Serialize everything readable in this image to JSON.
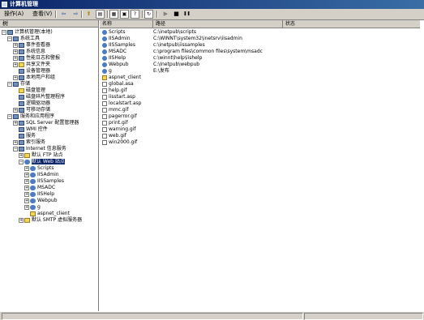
{
  "window": {
    "title": "计算机管理"
  },
  "menu": {
    "action": "操作(A)",
    "view": "查看(V)"
  },
  "toolbar": {
    "back": "⇦",
    "forward": "⇨",
    "up": "⬆",
    "show_tree": "▤",
    "export": "▦",
    "properties": "▣",
    "help": "?",
    "refresh": "↻",
    "play": "▶",
    "stop": "■",
    "pause": "❚❚"
  },
  "left_pane": {
    "header": "树",
    "tree": [
      {
        "label": "计算机管理(本地)",
        "icon": "computer-icon"
      },
      {
        "label": "系统工具",
        "icon": "tools-icon"
      },
      {
        "label": "事件查看器",
        "icon": "event-viewer-icon"
      },
      {
        "label": "系统信息",
        "icon": "system-info-icon"
      },
      {
        "label": "性能日志和警报",
        "icon": "performance-icon"
      },
      {
        "label": "共享文件夹",
        "icon": "shared-folder-icon"
      },
      {
        "label": "设备管理器",
        "icon": "device-manager-icon"
      },
      {
        "label": "本地用户和组",
        "icon": "users-icon"
      },
      {
        "label": "存储",
        "icon": "storage-icon"
      },
      {
        "label": "磁盘管理",
        "icon": "disk-icon"
      },
      {
        "label": "磁盘碎片整理程序",
        "icon": "defrag-icon"
      },
      {
        "label": "逻辑驱动器",
        "icon": "drive-icon"
      },
      {
        "label": "可移动存储",
        "icon": "removable-icon"
      },
      {
        "label": "服务和应用程序",
        "icon": "services-apps-icon"
      },
      {
        "label": "SQL Server 配置管理器",
        "icon": "sql-icon"
      },
      {
        "label": "WMI 控件",
        "icon": "wmi-icon"
      },
      {
        "label": "服务",
        "icon": "services-icon"
      },
      {
        "label": "索引服务",
        "icon": "index-icon"
      },
      {
        "label": "Internet 信息服务",
        "icon": "iis-icon"
      },
      {
        "label": "默认 FTP 站点",
        "icon": "ftp-icon"
      },
      {
        "label": "默认 Web 站点",
        "icon": "web-site-icon"
      },
      {
        "label": "Scripts",
        "icon": "web-folder-icon"
      },
      {
        "label": "IISAdmin",
        "icon": "web-folder-icon"
      },
      {
        "label": "IISSamples",
        "icon": "web-folder-icon"
      },
      {
        "label": "MSADC",
        "icon": "web-folder-icon"
      },
      {
        "label": "IISHelp",
        "icon": "web-folder-icon"
      },
      {
        "label": "Webpub",
        "icon": "web-folder-icon"
      },
      {
        "label": "g",
        "icon": "web-folder-icon"
      },
      {
        "label": "aspnet_client",
        "icon": "folder-icon"
      },
      {
        "label": "默认 SMTP 虚拟服务器",
        "icon": "smtp-icon"
      }
    ]
  },
  "right_pane": {
    "columns": {
      "name": "名称",
      "path": "路径",
      "status": "状态"
    },
    "items": [
      {
        "name": "Scripts",
        "path": "C:\\inetpub\\scripts",
        "icon": "web-folder-icon"
      },
      {
        "name": "IISAdmin",
        "path": "C:\\WINNT\\system32\\inetsrv\\iisadmin",
        "icon": "web-folder-icon"
      },
      {
        "name": "IISSamples",
        "path": "c:\\inetpub\\iissamples",
        "icon": "web-folder-icon"
      },
      {
        "name": "MSADC",
        "path": "c:\\program files\\common files\\system\\msadc",
        "icon": "web-folder-icon"
      },
      {
        "name": "IISHelp",
        "path": "c:\\winnt\\help\\iishelp",
        "icon": "web-folder-icon"
      },
      {
        "name": "Webpub",
        "path": "C:\\Inetpub\\webpub",
        "icon": "web-folder-icon"
      },
      {
        "name": "g",
        "path": "E:\\发布",
        "icon": "web-folder-icon"
      },
      {
        "name": "aspnet_client",
        "path": "",
        "icon": "folder-icon"
      },
      {
        "name": "global.asa",
        "path": "",
        "icon": "file-icon"
      },
      {
        "name": "help.gif",
        "path": "",
        "icon": "file-icon"
      },
      {
        "name": "iisstart.asp",
        "path": "",
        "icon": "file-icon"
      },
      {
        "name": "localstart.asp",
        "path": "",
        "icon": "file-icon"
      },
      {
        "name": "mmc.gif",
        "path": "",
        "icon": "file-icon"
      },
      {
        "name": "pagerror.gif",
        "path": "",
        "icon": "file-icon"
      },
      {
        "name": "print.gif",
        "path": "",
        "icon": "file-icon"
      },
      {
        "name": "warning.gif",
        "path": "",
        "icon": "file-icon"
      },
      {
        "name": "web.gif",
        "path": "",
        "icon": "file-icon"
      },
      {
        "name": "win2000.gif",
        "path": "",
        "icon": "file-icon"
      }
    ]
  },
  "colors": {
    "titlebar": "#0a246a",
    "selection": "#0a246a",
    "chrome": "#d4d0c8"
  }
}
